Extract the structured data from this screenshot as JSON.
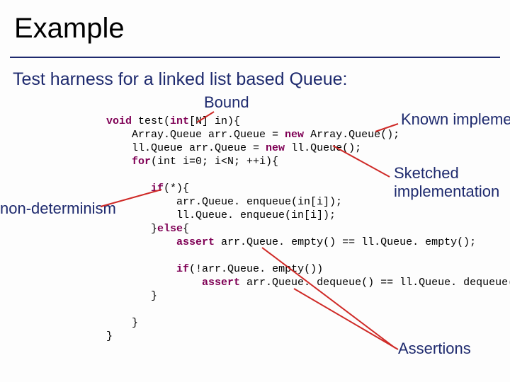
{
  "title": "Example",
  "subtitle": "Test harness for a linked list based Queue:",
  "labels": {
    "bound": "Bound",
    "known": "Known implementa",
    "sketched1": "Sketched",
    "sketched2": "implementation",
    "nondet": "non-determinism",
    "assertions": "Assertions"
  },
  "kw": {
    "void": "void",
    "int": "int",
    "new1": "new",
    "new2": "new",
    "for": "for",
    "if": "if",
    "else": "else",
    "assert1": "assert",
    "if2": "if",
    "assert2": "assert"
  },
  "code": {
    "sig_a": " test(",
    "sig_b": "[N] in){",
    "l2a": "    Array.Queue arr.Queue = ",
    "l2b": " Array.Queue();",
    "l3a": "    ll.Queue arr.Queue = ",
    "l3b": " ll.Queue();",
    "l4a": "    ",
    "l4b": "(int i=0; i<N; ++i){",
    "blank": "",
    "l6a": "       ",
    "l6b": "(*){",
    "l7": "           arr.Queue. enqueue(in[i]);",
    "l8": "           ll.Queue. enqueue(in[i]);",
    "l9a": "       }",
    "l9b": "{",
    "l10a": "           ",
    "l10b": " arr.Queue. empty() == ll.Queue. empty();",
    "l12a": "           ",
    "l12b": "(!arr.Queue. empty())",
    "l13a": "               ",
    "l13b": " arr.Queue. dequeue() == ll.Queue. dequeue();",
    "l14": "       }",
    "l16": "    }",
    "l17": "}"
  }
}
